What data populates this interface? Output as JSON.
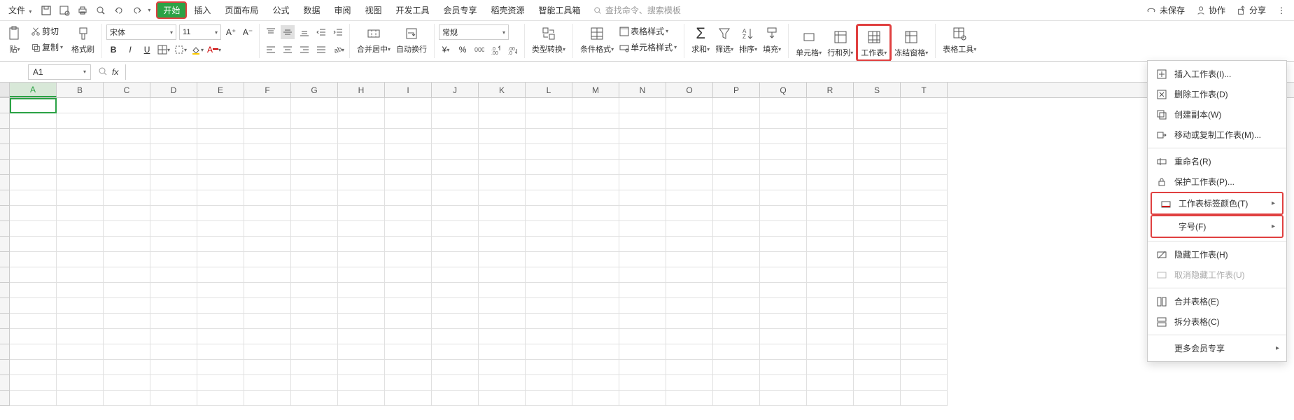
{
  "topmenu": {
    "file": "文件",
    "tabs": [
      "开始",
      "插入",
      "页面布局",
      "公式",
      "数据",
      "审阅",
      "视图",
      "开发工具",
      "会员专享",
      "稻壳资源",
      "智能工具箱"
    ],
    "search_placeholder": "查找命令、搜索模板",
    "unsaved": "未保存",
    "collab": "协作",
    "share": "分享"
  },
  "ribbon": {
    "cut": "剪切",
    "copy": "复制",
    "format_painter": "格式刷",
    "paste": "贴",
    "font_name": "宋体",
    "font_size": "11",
    "merge_center": "合并居中",
    "auto_wrap": "自动换行",
    "general": "常规",
    "type_convert": "类型转换",
    "cond_format": "条件格式",
    "table_style": "表格样式",
    "cell_style": "单元格样式",
    "sum": "求和",
    "filter": "筛选",
    "sort": "排序",
    "fill": "填充",
    "cells": "单元格",
    "rows_cols": "行和列",
    "worksheet": "工作表",
    "freeze_panes": "冻结窗格",
    "table_tools": "表格工具"
  },
  "formula": {
    "cell_ref": "A1",
    "fx": "fx"
  },
  "columns": [
    "A",
    "B",
    "C",
    "D",
    "E",
    "F",
    "G",
    "H",
    "I",
    "J",
    "K",
    "L",
    "M",
    "N",
    "O",
    "P",
    "Q",
    "R",
    "S",
    "T"
  ],
  "menu": {
    "insert": "插入工作表(I)...",
    "delete": "删除工作表(D)",
    "duplicate": "创建副本(W)",
    "move_copy": "移动或复制工作表(M)...",
    "rename": "重命名(R)",
    "protect": "保护工作表(P)...",
    "tab_color": "工作表标签颜色(T)",
    "font_size": "字号(F)",
    "hide": "隐藏工作表(H)",
    "unhide": "取消隐藏工作表(U)",
    "merge_tables": "合并表格(E)",
    "split_tables": "拆分表格(C)",
    "more_member": "更多会员专享"
  }
}
